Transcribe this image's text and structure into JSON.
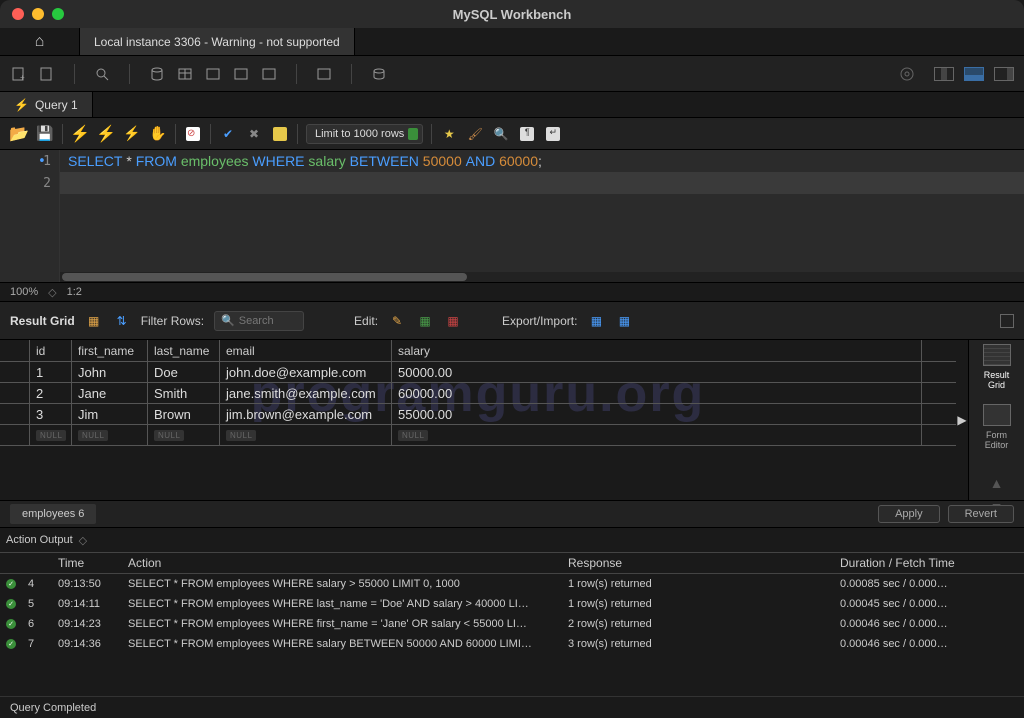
{
  "app": {
    "title": "MySQL Workbench"
  },
  "connection": {
    "tab_label": "Local instance 3306 - Warning - not supported"
  },
  "query_tab": {
    "label": "Query 1"
  },
  "query_toolbar": {
    "limit_label": "Limit to 1000 rows"
  },
  "sql": {
    "line1_parts": {
      "kw1": "SELECT",
      "star": "*",
      "kw2": "FROM",
      "tbl": "employees",
      "kw3": "WHERE",
      "col": "salary",
      "kw4": "BETWEEN",
      "n1": "50000",
      "kw5": "AND",
      "n2": "60000",
      "semi": ";"
    }
  },
  "zoom": {
    "pct": "100%",
    "pos": "1:2"
  },
  "result_toolbar": {
    "title": "Result Grid",
    "filter_label": "Filter Rows:",
    "search_placeholder": "Search",
    "edit_label": "Edit:",
    "export_label": "Export/Import:"
  },
  "columns": {
    "id": "id",
    "first_name": "first_name",
    "last_name": "last_name",
    "email": "email",
    "salary": "salary"
  },
  "rows": [
    {
      "id": "1",
      "first_name": "John",
      "last_name": "Doe",
      "email": "john.doe@example.com",
      "salary": "50000.00"
    },
    {
      "id": "2",
      "first_name": "Jane",
      "last_name": "Smith",
      "email": "jane.smith@example.com",
      "salary": "60000.00"
    },
    {
      "id": "3",
      "first_name": "Jim",
      "last_name": "Brown",
      "email": "jim.brown@example.com",
      "salary": "55000.00"
    }
  ],
  "null_label": "NULL",
  "side": {
    "grid": "Result\nGrid",
    "form": "Form\nEditor"
  },
  "result_footer": {
    "tab": "employees 6",
    "apply": "Apply",
    "revert": "Revert"
  },
  "action_output": {
    "title": "Action Output",
    "headers": {
      "time": "Time",
      "action": "Action",
      "response": "Response",
      "duration": "Duration / Fetch Time"
    },
    "rows": [
      {
        "n": "4",
        "time": "09:13:50",
        "action": "SELECT * FROM employees WHERE salary > 55000 LIMIT 0, 1000",
        "response": "1 row(s) returned",
        "duration": "0.00085 sec / 0.000…"
      },
      {
        "n": "5",
        "time": "09:14:11",
        "action": "SELECT * FROM employees WHERE last_name = 'Doe' AND salary > 40000 LI…",
        "response": "1 row(s) returned",
        "duration": "0.00045 sec / 0.000…"
      },
      {
        "n": "6",
        "time": "09:14:23",
        "action": "SELECT * FROM employees WHERE first_name = 'Jane' OR salary < 55000 LI…",
        "response": "2 row(s) returned",
        "duration": "0.00046 sec / 0.000…"
      },
      {
        "n": "7",
        "time": "09:14:36",
        "action": "SELECT * FROM employees WHERE salary BETWEEN 50000 AND 60000 LIMI…",
        "response": "3 row(s) returned",
        "duration": "0.00046 sec / 0.000…"
      }
    ]
  },
  "status": {
    "text": "Query Completed"
  },
  "watermark": "programguru.org"
}
